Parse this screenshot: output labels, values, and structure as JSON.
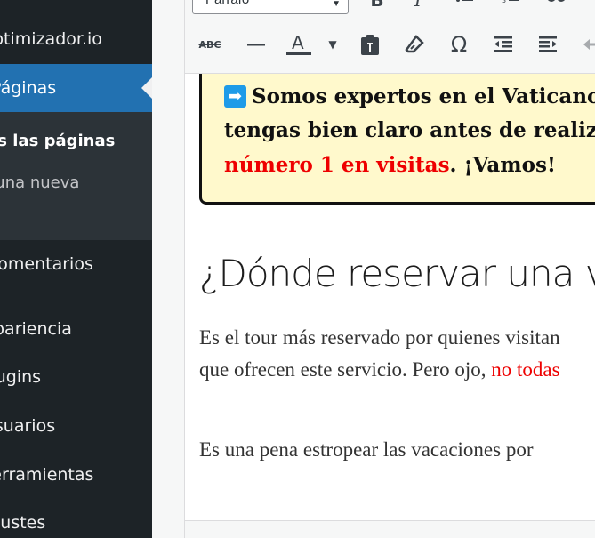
{
  "sidebar": {
    "items": [
      {
        "label": "ptimizador.io"
      },
      {
        "label": "Páginas"
      },
      {
        "label": "Comentarios"
      },
      {
        "label": "Apariencia"
      },
      {
        "label": "Plugins"
      },
      {
        "label": "Usuarios"
      },
      {
        "label": "Herramientas"
      },
      {
        "label": "Ajustes"
      }
    ],
    "submenu": {
      "todas": "Todas las páginas",
      "nueva": "Añadir una nueva"
    }
  },
  "toolbar": {
    "format_select": "Párrafo"
  },
  "content": {
    "notice": {
      "line1": "Somos expertos en el Vaticano",
      "line2": "tengas bien claro antes de realizar",
      "line3_red": "número 1 en visitas",
      "line3_rest": ". ¡Vamos!"
    },
    "heading": "¿Dónde reservar una visita",
    "para1_line1": "Es el tour más reservado por quienes visitan",
    "para1_line2_start": "que ofrecen este servicio. Pero ojo, ",
    "para1_line2_red": "no todas",
    "para2": "Es una pena estropear las vacaciones por"
  },
  "colors": {
    "sidebar_bg": "#1d2327",
    "active_bg": "#2271b1",
    "notice_bg": "#fff9cc",
    "accent_red": "#e00000",
    "arrow_blue": "#1e9be8"
  }
}
